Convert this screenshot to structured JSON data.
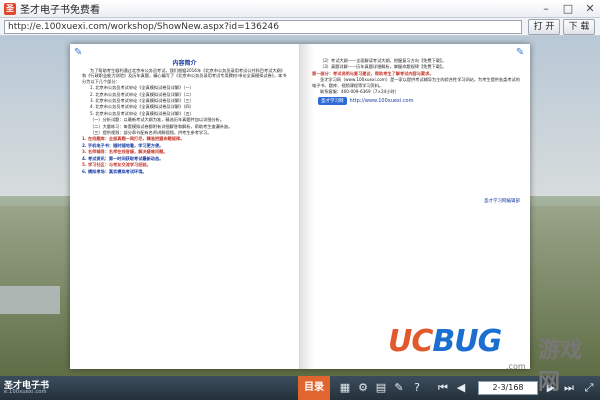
{
  "window": {
    "title": "圣才电子书免费看",
    "controls": [
      "minimize",
      "maximize",
      "close"
    ]
  },
  "address": {
    "url": "http://e.100xuexi.com/workshop/ShowNew.aspx?id=136246",
    "open_label": "打 开",
    "download_label": "下 载"
  },
  "book": {
    "left_page": {
      "title": "内容简介",
      "paragraphs": [
        "为了帮助考生顺利通过北京市公务员考试，我们根据2016年《北京市公务员录用考试公共科目考试大纲》和《行政职业能力测验》及历年真题，精心编写了《北京市公务员录用考试专用教材·申论全真模拟试卷》，本书分为以下几个部分：",
        "1. 北京市公务员考试申论《全真模拟试卷及详解》（一）",
        "2. 北京市公务员考试申论《全真模拟试卷及详解》（二）",
        "3. 北京市公务员考试申论《全真模拟试卷及详解》（三）",
        "4. 北京市公务员考试申论《全真模拟试卷及详解》（四）",
        "5. 北京市公务员考试申论《全真模拟试卷及详解》（五）",
        "（一）分析试题：以最新考试大纲为准，精选历年真题并加以详细分析。",
        "（二）大量练习：每套模拟试卷都附有详细解答和解析，帮助考生查漏补缺。",
        "（三）提供视频：部分章节配有名师讲解视频，供考生参考学习。"
      ],
      "sections": [
        "1. 在线题库：全部真题一网打尽，精准把握命题规律。",
        "2. 手机电子书：随时随地看，学习更方便。",
        "3. 名师辅导：名师在线答疑，解决疑难问题。",
        "4. 考试资讯：第一时间获取考试最新动态。",
        "5. 学习社区：与考友交流学习经验。",
        "6. 模拟考场：真实模拟考试环境。"
      ]
    },
    "right_page": {
      "paragraphs": [
        "（2）考试大纲——全面解读考试大纲，把握复习方向【免费下载】。",
        "（3）真题详解——历年真题详细解析，掌握命题规律【免费下载】。",
        "第一部分：考试说明与复习建议，帮助考生了解考试内容与要求。",
        "圣才学习网（www.100xuexi.com）是一家以提供考试辅导为主的综合性学习网站，为考生提供各类考试的电子书、题库、视频课程等学习资料。",
        "联系客服：400-009-6369（7×24小时）"
      ],
      "logo_text": "圣才学习网",
      "site": "http://www.100xuexi.com",
      "footer": "圣才学习网编辑部"
    }
  },
  "toolbar": {
    "brand": "圣才电子书",
    "brand_sub": "e.100xuexi.com",
    "toc_label": "目录",
    "page_value": "2-3/168"
  },
  "watermark": {
    "ucbug_uc": "UC",
    "ucbug_bug": "BUG",
    "cn_text": "游戏网",
    "domain": ".com"
  },
  "colors": {
    "toc": "#e0652e",
    "toolbar": "#2a3843",
    "link": "#1a3da6"
  }
}
